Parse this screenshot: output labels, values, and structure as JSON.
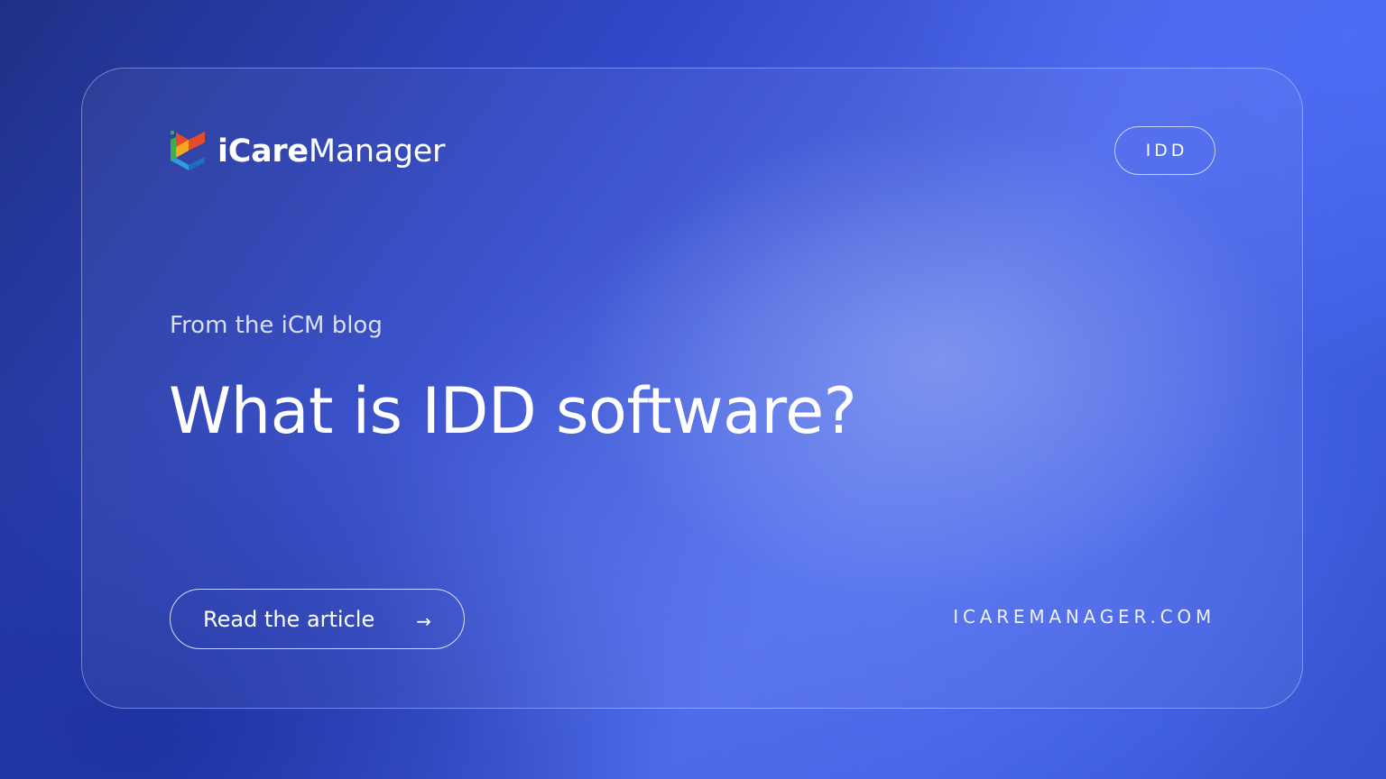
{
  "brand": {
    "name_bold": "iCare",
    "name_light": "Manager",
    "logo_icon": "icaremanager-logo-icon",
    "logo_colors": [
      "#e84a2c",
      "#3cae4a",
      "#2f9de0",
      "#f5a623"
    ]
  },
  "tag": {
    "label": "IDD"
  },
  "content": {
    "eyebrow": "From the iCM blog",
    "headline": "What is IDD software?"
  },
  "cta": {
    "label": "Read the article",
    "arrow": "→",
    "arrow_icon": "arrow-right-icon"
  },
  "footer": {
    "site_url": "ICAREMANAGER.COM"
  },
  "colors": {
    "background": "#3149c9",
    "text": "#ffffff"
  }
}
